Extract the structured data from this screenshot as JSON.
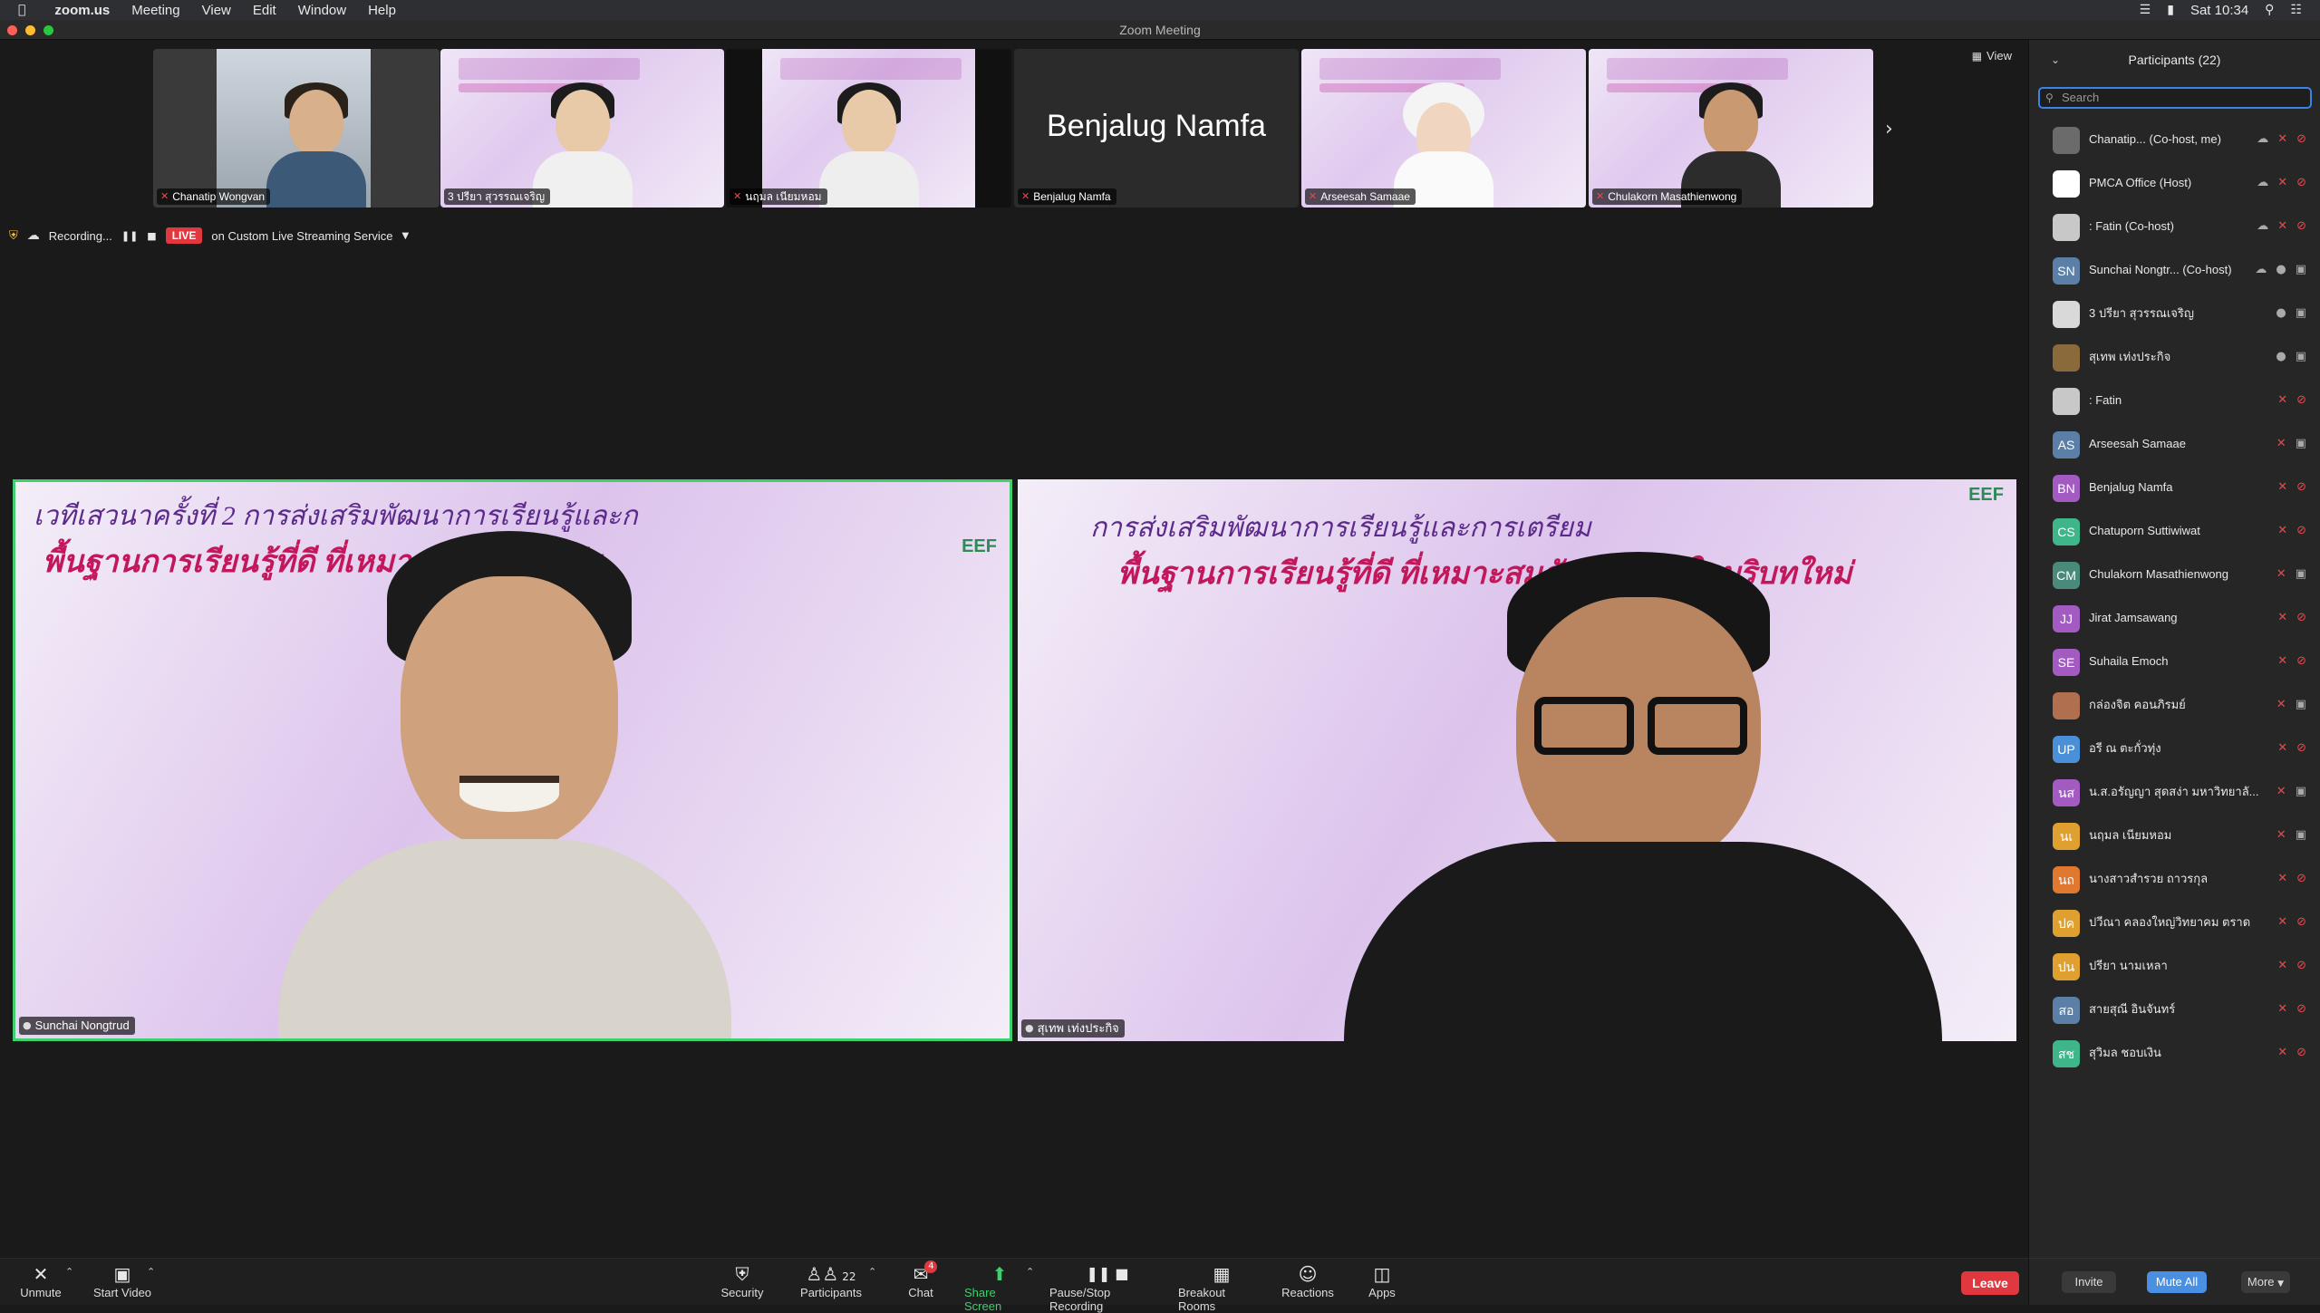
{
  "menubar": {
    "app": "zoom.us",
    "items": [
      "Meeting",
      "View",
      "Edit",
      "Window",
      "Help"
    ],
    "clock": "Sat 10:34"
  },
  "window": {
    "title": "Zoom Meeting"
  },
  "view_label": "View",
  "thumbnails": [
    {
      "name": "Chanatip Wongvan"
    },
    {
      "name": "3 ปรียา สุวรรณเจริญ"
    },
    {
      "name": "นฤมล เนียมหอม"
    },
    {
      "name": "Benjalug Namfa",
      "big_text": "Benjalug Namfa"
    },
    {
      "name": "Arseesah Samaae"
    },
    {
      "name": "Chulakorn Masathienwong"
    }
  ],
  "recording": {
    "status": "Recording...",
    "live": "LIVE",
    "service": "on Custom Live Streaming Service"
  },
  "speakers": [
    {
      "name": "Sunchai Nongtrud",
      "slide_line1": "เวทีเสวนาครั้งที่ 2  การส่งเสริมพัฒนาการเรียนรู้และก",
      "slide_line2": "พื้นฐานการเรียนรู้ที่ดี ที่เหมาะสมกับ ช่วงวัย",
      "brand": "EEF"
    },
    {
      "name": "สุเทพ เท่งประกิจ",
      "slide_line1": "การส่งเสริมพัฒนาการเรียนรู้และการเตรียม",
      "slide_line2": "พื้นฐานการเรียนรู้ที่ดี ที่เหมาะสมกับ ช่วงวัย ในบริบทใหม่",
      "brand": "EEF"
    }
  ],
  "toolbar": {
    "unmute": "Unmute",
    "start_video": "Start Video",
    "security": "Security",
    "participants": "Participants",
    "participants_count": "22",
    "chat": "Chat",
    "chat_badge": "4",
    "share": "Share Screen",
    "record": "Pause/Stop Recording",
    "breakout": "Breakout Rooms",
    "reactions": "Reactions",
    "apps": "Apps",
    "leave": "Leave"
  },
  "panel": {
    "title": "Participants (22)",
    "search_placeholder": "Search",
    "participants": [
      {
        "name": "Chanatip...   (Co-host, me)",
        "initials": "",
        "color": "#6b6b6b",
        "mic": "off",
        "cam": "off",
        "cloud": true
      },
      {
        "name": "PMCA Office (Host)",
        "initials": "",
        "color": "#ffffff",
        "mic": "off",
        "cam": "off",
        "cloud": true
      },
      {
        "name": ": Fatin (Co-host)",
        "initials": "",
        "color": "#c8c8c8",
        "mic": "off",
        "cam": "off",
        "cloud": true
      },
      {
        "name": "Sunchai Nongtr...  (Co-host)",
        "initials": "SN",
        "color": "#5b7fa6",
        "mic": "on",
        "cam": "on",
        "cloud": true
      },
      {
        "name": "3 ปรียา สุวรรณเจริญ",
        "initials": "",
        "color": "#d9d9d9",
        "mic": "on",
        "cam": "on",
        "cloud": false
      },
      {
        "name": "สุเทพ เท่งประกิจ",
        "initials": "",
        "color": "#8a6a3a",
        "mic": "on",
        "cam": "on",
        "cloud": false
      },
      {
        "name": ": Fatin",
        "initials": "",
        "color": "#c8c8c8",
        "mic": "off",
        "cam": "off",
        "cloud": false
      },
      {
        "name": "Arseesah Samaae",
        "initials": "AS",
        "color": "#5b7fa6",
        "mic": "off",
        "cam": "on",
        "cloud": false
      },
      {
        "name": "Benjalug Namfa",
        "initials": "BN",
        "color": "#a35bc2",
        "mic": "off",
        "cam": "off",
        "cloud": false
      },
      {
        "name": "Chatuporn Suttiwiwat",
        "initials": "CS",
        "color": "#3fb58a",
        "mic": "off",
        "cam": "off",
        "cloud": false
      },
      {
        "name": "Chulakorn Masathienwong",
        "initials": "CM",
        "color": "#4a8a7a",
        "mic": "off",
        "cam": "on",
        "cloud": false
      },
      {
        "name": "Jirat Jamsawang",
        "initials": "JJ",
        "color": "#a35bc2",
        "mic": "off",
        "cam": "off",
        "cloud": false
      },
      {
        "name": "Suhaila Emoch",
        "initials": "SE",
        "color": "#a35bc2",
        "mic": "off",
        "cam": "off",
        "cloud": false
      },
      {
        "name": "กล่องจิต คอนภิรมย์",
        "initials": "",
        "color": "#b07050",
        "mic": "off",
        "cam": "on",
        "cloud": false
      },
      {
        "name": "อรี ณ ตะกั่วทุ่ง",
        "initials": "UP",
        "color": "#4a90d9",
        "mic": "off",
        "cam": "off",
        "cloud": false
      },
      {
        "name": "น.ส.อรัญญา  สุดสง่า มหาวิทยาลั...",
        "initials": "นส",
        "color": "#a35bc2",
        "mic": "off",
        "cam": "on",
        "cloud": false
      },
      {
        "name": "นฤมล เนียมหอม",
        "initials": "นเ",
        "color": "#e0a030",
        "mic": "off",
        "cam": "on",
        "cloud": false
      },
      {
        "name": "นางสาวสำรวย ถาวรกุล",
        "initials": "นถ",
        "color": "#e07830",
        "mic": "off",
        "cam": "off",
        "cloud": false
      },
      {
        "name": "ปวีณา คลองใหญ่วิทยาคม ตราด",
        "initials": "ปค",
        "color": "#e0a030",
        "mic": "off",
        "cam": "off",
        "cloud": false
      },
      {
        "name": "ปรียา นามเหลา",
        "initials": "ปน",
        "color": "#e0a030",
        "mic": "off",
        "cam": "off",
        "cloud": false
      },
      {
        "name": "สายสุณี อินจันทร์",
        "initials": "สอ",
        "color": "#5b7fa6",
        "mic": "off",
        "cam": "off",
        "cloud": false
      },
      {
        "name": "สุวิมล  ชอบเงิน",
        "initials": "สช",
        "color": "#3fb58a",
        "mic": "off",
        "cam": "off",
        "cloud": false
      }
    ],
    "invite": "Invite",
    "mute_all": "Mute All",
    "more": "More"
  }
}
